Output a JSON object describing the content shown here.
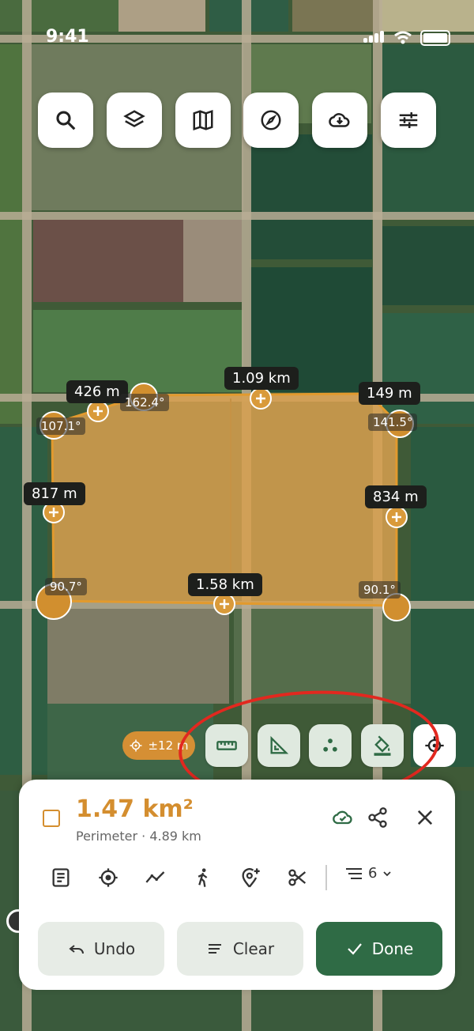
{
  "status_bar": {
    "time": "9:41"
  },
  "toolbar": {
    "buttons": [
      {
        "name": "search",
        "icon": "search-icon"
      },
      {
        "name": "layers",
        "icon": "layers-icon"
      },
      {
        "name": "map",
        "icon": "map-icon"
      },
      {
        "name": "compass",
        "icon": "compass-icon"
      },
      {
        "name": "download",
        "icon": "cloud-download-icon"
      },
      {
        "name": "settings",
        "icon": "sliders-icon"
      }
    ]
  },
  "measurements": {
    "segments": [
      "426 m",
      "1.09 km",
      "149 m",
      "817 m",
      "834 m",
      "1.58 km"
    ],
    "angles": [
      "162.4°",
      "107.1°",
      "141.5°",
      "90.7°",
      "90.1°"
    ]
  },
  "accuracy_chip": "±12 m",
  "tools": [
    "ruler-icon",
    "angle-icon",
    "points-icon",
    "paint-bucket-icon"
  ],
  "panel": {
    "area": "1.47 km²",
    "perimeter": "Perimeter · 4.89 km",
    "vertex_count": "6",
    "buttons": {
      "undo": "Undo",
      "clear": "Clear",
      "done": "Done"
    }
  },
  "colors": {
    "accent": "#d48e2f",
    "primary": "#2f6b45"
  }
}
